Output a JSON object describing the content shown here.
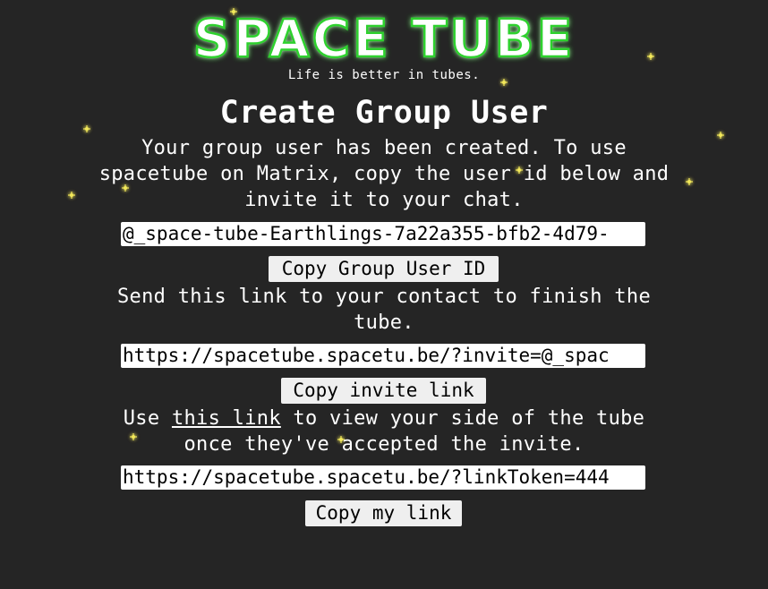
{
  "header": {
    "logo_text": "SPACE TUBE",
    "tagline": "Life is better in tubes."
  },
  "main": {
    "title": "Create Group User",
    "intro": "Your group user has been created. To use spacetube on Matrix, copy the user id below and invite it to your chat.",
    "group_user_id_value": "@_space-tube-Earthlings-7a22a355-bfb2-4d79-",
    "copy_group_user_button": "Copy Group User ID",
    "invite_instruction": "Send this link to your contact to finish the tube.",
    "invite_link_value": "https://spacetube.spacetu.be/?invite=@_spac",
    "copy_invite_button": "Copy invite link",
    "view_prefix": "Use ",
    "view_link_text": "this link",
    "view_suffix": " to view your side of the tube once they've accepted the invite.",
    "my_link_value": "https://spacetube.spacetu.be/?linkToken=444",
    "copy_my_link_button": "Copy my link"
  },
  "colors": {
    "background": "#252525",
    "logo_green": "#2fd12f",
    "star": "#f2e85a"
  }
}
